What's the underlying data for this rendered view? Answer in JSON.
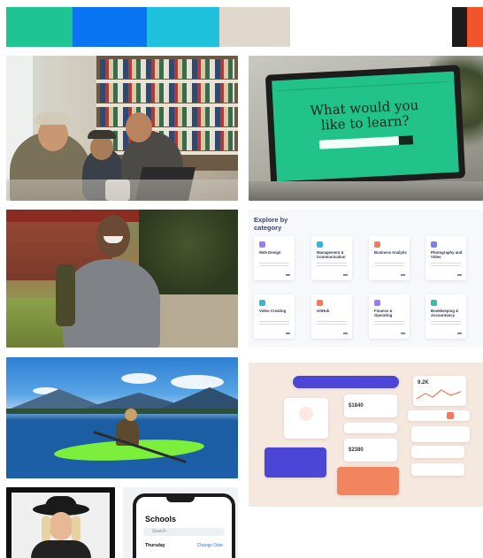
{
  "palette": {
    "swatches": [
      {
        "name": "green",
        "color": "#1fc493"
      },
      {
        "name": "blue",
        "color": "#0a75f2"
      },
      {
        "name": "cyan",
        "color": "#1fc2dc"
      },
      {
        "name": "sand",
        "color": "#e0d8cc"
      },
      {
        "name": "white",
        "color": "#ffffff"
      },
      {
        "name": "black",
        "color": "#1c1c1c"
      },
      {
        "name": "orange",
        "color": "#f2542d"
      }
    ]
  },
  "laptop": {
    "headline_line1": "What would you",
    "headline_line2": "like to learn?"
  },
  "explore": {
    "title_line1": "Explore by",
    "title_line2": "category",
    "categories": [
      {
        "label": "Web Design",
        "color": "#9b7cf2"
      },
      {
        "label": "Management & Communication",
        "color": "#37b6d6"
      },
      {
        "label": "Business Analytic",
        "color": "#f27a5a"
      },
      {
        "label": "Photography and Video",
        "color": "#7b83e8"
      },
      {
        "label": "Video Creating",
        "color": "#37b6d6"
      },
      {
        "label": "GitHub",
        "color": "#f27a5a"
      },
      {
        "label": "Finance & Operating",
        "color": "#9b7cf2"
      },
      {
        "label": "Bookkeeping & Accountancy",
        "color": "#2fc2a3"
      }
    ]
  },
  "dashboard": {
    "amount_a": "$1840",
    "amount_b": "$2380",
    "amount_c": "9.2K"
  },
  "phone": {
    "title": "Schools",
    "search_placeholder": "Search",
    "day": "Thursday",
    "link": "Change Date"
  }
}
